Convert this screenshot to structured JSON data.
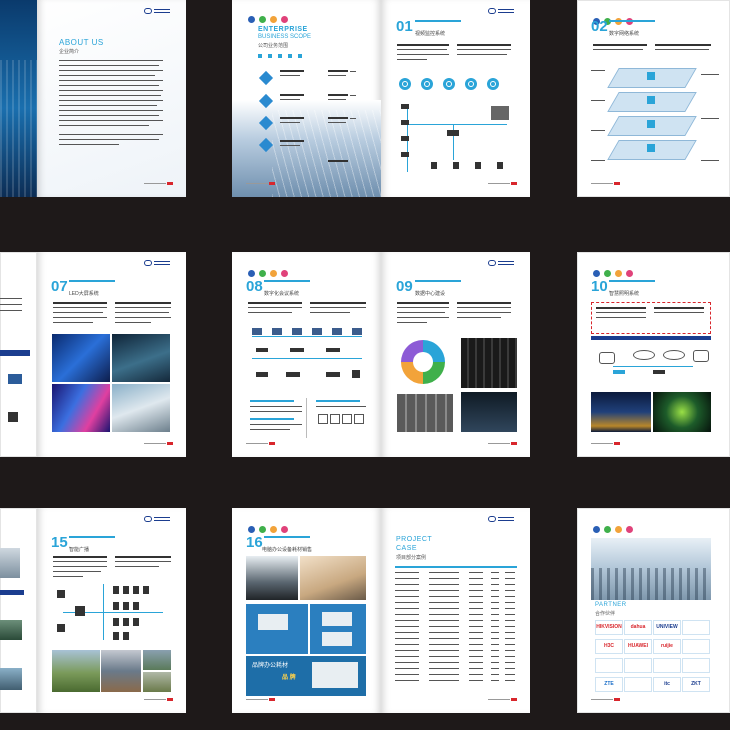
{
  "about": {
    "title": "ABOUT US",
    "subtitle": "企业简介"
  },
  "scope": {
    "title": "ENTERPRISE",
    "title2": "BUSINESS SCOPE",
    "subtitle": "公司业务范围"
  },
  "sections": {
    "s01": {
      "num": "01",
      "title": "视频监控系统"
    },
    "s02": {
      "num": "02",
      "title": "数字网络系统"
    },
    "s07": {
      "num": "07",
      "title": "LED大屏系统"
    },
    "s08": {
      "num": "08",
      "title": "数字化会议系统"
    },
    "s09": {
      "num": "09",
      "title": "数据中心建设"
    },
    "s10": {
      "num": "10",
      "title": "智慧照明系统"
    },
    "s15": {
      "num": "15",
      "title": "智能广播"
    },
    "s16": {
      "num": "16",
      "title": "电脑办公设备耗材销售"
    }
  },
  "office_banner": {
    "line1": "品牌办公耗材",
    "line2": "品 牌"
  },
  "case": {
    "title1": "PROJECT",
    "title2": "CASE",
    "subtitle": "项目部分案例"
  },
  "partners": {
    "title": "PARTNER",
    "subtitle": "合作伙伴",
    "logos": [
      "HIKVISION",
      "dahua",
      "UNIVIEW",
      "",
      "H3C",
      "HUAWEI",
      "ruijie",
      "",
      "",
      "",
      "",
      "",
      "ZTE",
      "",
      "itc",
      "ZKT"
    ]
  },
  "colors": {
    "accent": "#2aa4d8",
    "brand": "#1b3d8f",
    "background": "#1e1919",
    "footer_mark": "#d8262c"
  }
}
